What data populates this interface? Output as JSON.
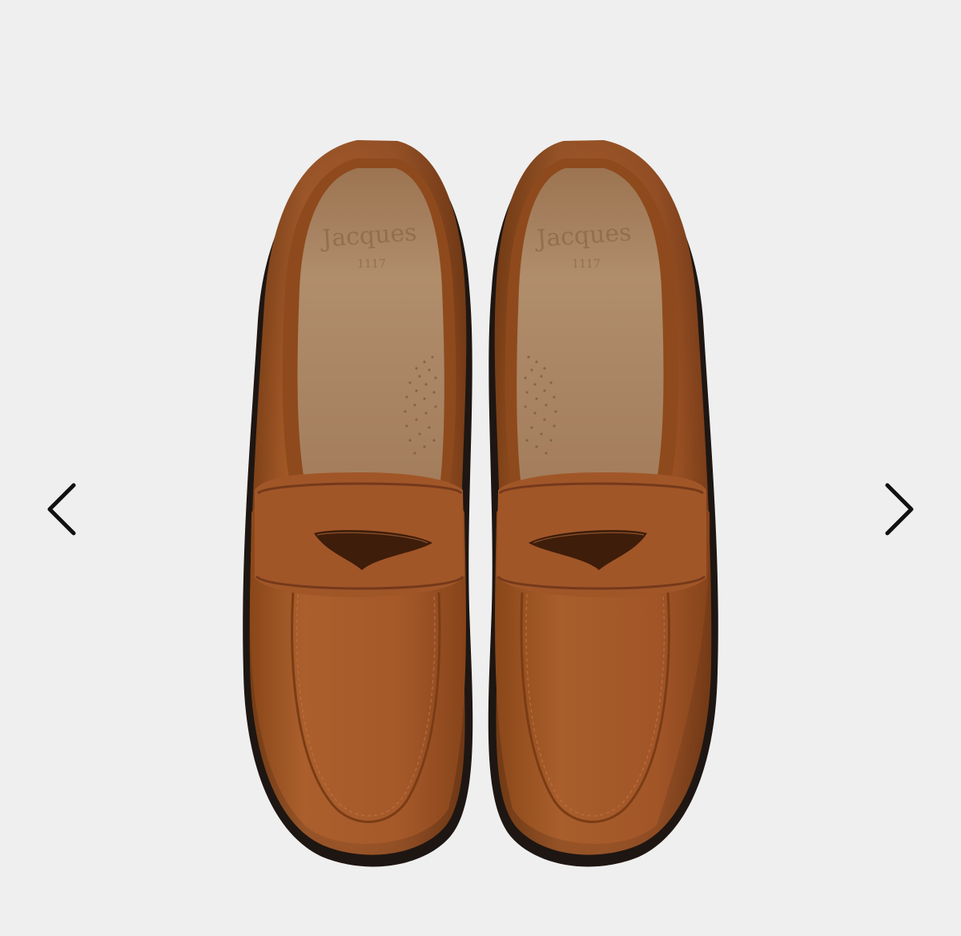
{
  "colors": {
    "background": "#efefef",
    "suede": "#a4592a",
    "suede_dark": "#7d3f18",
    "lining": "#a98462",
    "sole": "#1e1612",
    "arrow": "#111111"
  },
  "gallery": {
    "image_alt": "",
    "insole_logo": "Jacques",
    "insole_logo_number": "1117",
    "prev_icon": "chevron-left-icon",
    "next_icon": "chevron-right-icon"
  }
}
